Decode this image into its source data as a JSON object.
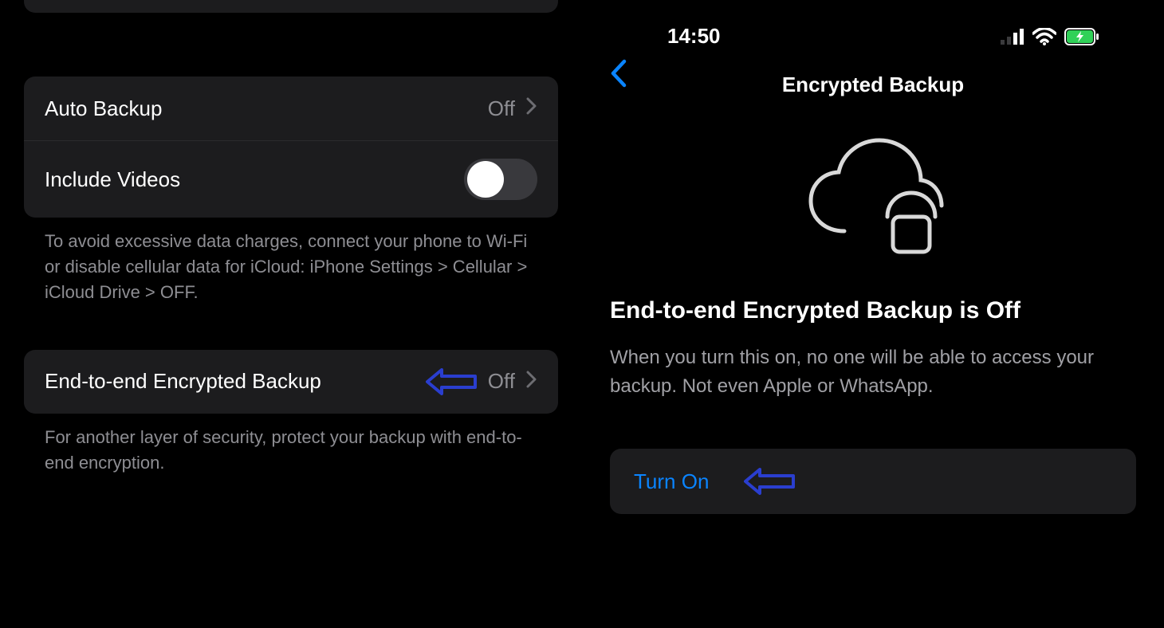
{
  "left": {
    "auto_backup": {
      "label": "Auto Backup",
      "value": "Off"
    },
    "include_videos": {
      "label": "Include Videos",
      "toggle_on": false
    },
    "data_note": "To avoid excessive data charges, connect your phone to Wi-Fi or disable cellular data for iCloud: iPhone Settings > Cellular > iCloud Drive > OFF.",
    "e2e_row": {
      "label": "End-to-end Encrypted Backup",
      "value": "Off"
    },
    "e2e_note": "For another layer of security, protect your backup with end-to-end encryption."
  },
  "right": {
    "status_time": "14:50",
    "nav_title": "Encrypted Backup",
    "headline": "End-to-end Encrypted Backup is Off",
    "body": "When you turn this on, no one will be able to access your backup. Not even Apple or WhatsApp.",
    "turn_on_label": "Turn On"
  }
}
